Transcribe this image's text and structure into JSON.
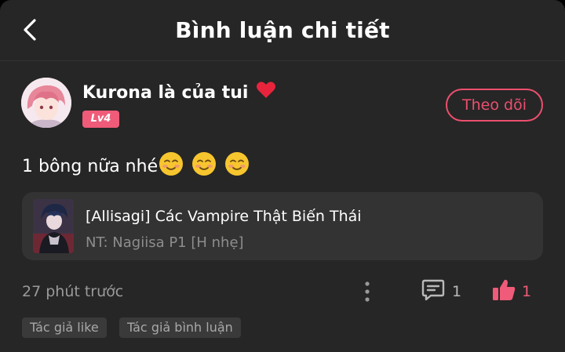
{
  "header": {
    "title": "Bình luận chi tiết"
  },
  "user": {
    "name": "Kurona là của tui",
    "level": "Lv4",
    "follow_label": "Theo dõi"
  },
  "comment": {
    "text": "1 bông nữa nhé"
  },
  "work": {
    "title": "[Allisagi] Các Vampire Thật Biến Thái",
    "subtitle": "NT: Nagiisa P1 [H nhẹ]"
  },
  "footer": {
    "timestamp": "27 phút trước",
    "comment_count": "1",
    "like_count": "1"
  },
  "tags": [
    "Tác giả like",
    "Tác giả bình luận"
  ],
  "icons": {
    "back": "chevron-left-icon",
    "heart": "heart-icon",
    "emoji": "blushing-smile-emoji",
    "more": "more-vertical-icon",
    "comment": "comment-icon",
    "like": "thumbs-up-icon"
  },
  "colors": {
    "background": "#262626",
    "accent": "#ec4f6e",
    "card": "#333333"
  }
}
